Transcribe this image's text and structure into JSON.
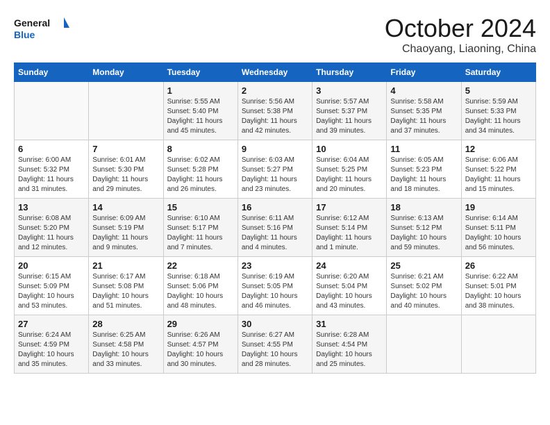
{
  "logo": {
    "line1": "General",
    "line2": "Blue"
  },
  "title": "October 2024",
  "subtitle": "Chaoyang, Liaoning, China",
  "days_header": [
    "Sunday",
    "Monday",
    "Tuesday",
    "Wednesday",
    "Thursday",
    "Friday",
    "Saturday"
  ],
  "weeks": [
    [
      {
        "num": "",
        "info": ""
      },
      {
        "num": "",
        "info": ""
      },
      {
        "num": "1",
        "info": "Sunrise: 5:55 AM\nSunset: 5:40 PM\nDaylight: 11 hours and 45 minutes."
      },
      {
        "num": "2",
        "info": "Sunrise: 5:56 AM\nSunset: 5:38 PM\nDaylight: 11 hours and 42 minutes."
      },
      {
        "num": "3",
        "info": "Sunrise: 5:57 AM\nSunset: 5:37 PM\nDaylight: 11 hours and 39 minutes."
      },
      {
        "num": "4",
        "info": "Sunrise: 5:58 AM\nSunset: 5:35 PM\nDaylight: 11 hours and 37 minutes."
      },
      {
        "num": "5",
        "info": "Sunrise: 5:59 AM\nSunset: 5:33 PM\nDaylight: 11 hours and 34 minutes."
      }
    ],
    [
      {
        "num": "6",
        "info": "Sunrise: 6:00 AM\nSunset: 5:32 PM\nDaylight: 11 hours and 31 minutes."
      },
      {
        "num": "7",
        "info": "Sunrise: 6:01 AM\nSunset: 5:30 PM\nDaylight: 11 hours and 29 minutes."
      },
      {
        "num": "8",
        "info": "Sunrise: 6:02 AM\nSunset: 5:28 PM\nDaylight: 11 hours and 26 minutes."
      },
      {
        "num": "9",
        "info": "Sunrise: 6:03 AM\nSunset: 5:27 PM\nDaylight: 11 hours and 23 minutes."
      },
      {
        "num": "10",
        "info": "Sunrise: 6:04 AM\nSunset: 5:25 PM\nDaylight: 11 hours and 20 minutes."
      },
      {
        "num": "11",
        "info": "Sunrise: 6:05 AM\nSunset: 5:23 PM\nDaylight: 11 hours and 18 minutes."
      },
      {
        "num": "12",
        "info": "Sunrise: 6:06 AM\nSunset: 5:22 PM\nDaylight: 11 hours and 15 minutes."
      }
    ],
    [
      {
        "num": "13",
        "info": "Sunrise: 6:08 AM\nSunset: 5:20 PM\nDaylight: 11 hours and 12 minutes."
      },
      {
        "num": "14",
        "info": "Sunrise: 6:09 AM\nSunset: 5:19 PM\nDaylight: 11 hours and 9 minutes."
      },
      {
        "num": "15",
        "info": "Sunrise: 6:10 AM\nSunset: 5:17 PM\nDaylight: 11 hours and 7 minutes."
      },
      {
        "num": "16",
        "info": "Sunrise: 6:11 AM\nSunset: 5:16 PM\nDaylight: 11 hours and 4 minutes."
      },
      {
        "num": "17",
        "info": "Sunrise: 6:12 AM\nSunset: 5:14 PM\nDaylight: 11 hours and 1 minute."
      },
      {
        "num": "18",
        "info": "Sunrise: 6:13 AM\nSunset: 5:12 PM\nDaylight: 10 hours and 59 minutes."
      },
      {
        "num": "19",
        "info": "Sunrise: 6:14 AM\nSunset: 5:11 PM\nDaylight: 10 hours and 56 minutes."
      }
    ],
    [
      {
        "num": "20",
        "info": "Sunrise: 6:15 AM\nSunset: 5:09 PM\nDaylight: 10 hours and 53 minutes."
      },
      {
        "num": "21",
        "info": "Sunrise: 6:17 AM\nSunset: 5:08 PM\nDaylight: 10 hours and 51 minutes."
      },
      {
        "num": "22",
        "info": "Sunrise: 6:18 AM\nSunset: 5:06 PM\nDaylight: 10 hours and 48 minutes."
      },
      {
        "num": "23",
        "info": "Sunrise: 6:19 AM\nSunset: 5:05 PM\nDaylight: 10 hours and 46 minutes."
      },
      {
        "num": "24",
        "info": "Sunrise: 6:20 AM\nSunset: 5:04 PM\nDaylight: 10 hours and 43 minutes."
      },
      {
        "num": "25",
        "info": "Sunrise: 6:21 AM\nSunset: 5:02 PM\nDaylight: 10 hours and 40 minutes."
      },
      {
        "num": "26",
        "info": "Sunrise: 6:22 AM\nSunset: 5:01 PM\nDaylight: 10 hours and 38 minutes."
      }
    ],
    [
      {
        "num": "27",
        "info": "Sunrise: 6:24 AM\nSunset: 4:59 PM\nDaylight: 10 hours and 35 minutes."
      },
      {
        "num": "28",
        "info": "Sunrise: 6:25 AM\nSunset: 4:58 PM\nDaylight: 10 hours and 33 minutes."
      },
      {
        "num": "29",
        "info": "Sunrise: 6:26 AM\nSunset: 4:57 PM\nDaylight: 10 hours and 30 minutes."
      },
      {
        "num": "30",
        "info": "Sunrise: 6:27 AM\nSunset: 4:55 PM\nDaylight: 10 hours and 28 minutes."
      },
      {
        "num": "31",
        "info": "Sunrise: 6:28 AM\nSunset: 4:54 PM\nDaylight: 10 hours and 25 minutes."
      },
      {
        "num": "",
        "info": ""
      },
      {
        "num": "",
        "info": ""
      }
    ]
  ]
}
